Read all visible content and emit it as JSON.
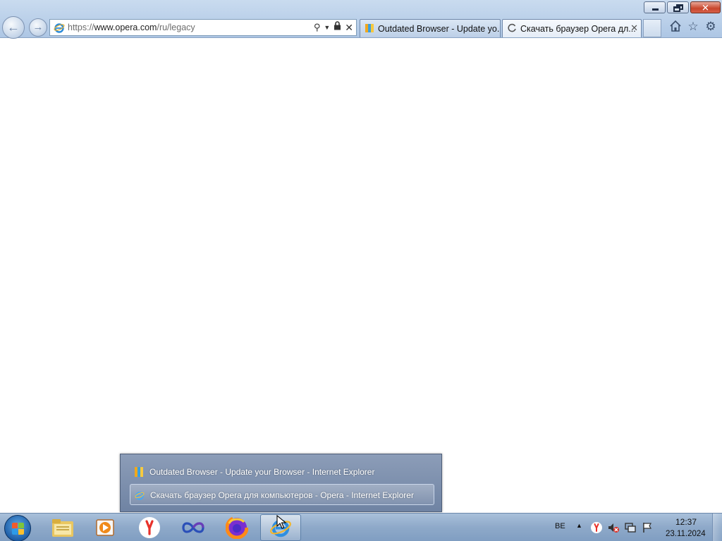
{
  "browser": {
    "address": {
      "scheme": "https://",
      "host": "www.opera.com",
      "path": "/ru/legacy"
    },
    "tabs": [
      {
        "title": "Outdated Browser - Update yo...",
        "active": false
      },
      {
        "title": "Скачать браузер Opera дл...",
        "active": true
      }
    ]
  },
  "jump_list": {
    "items": [
      {
        "label": "Outdated Browser - Update your Browser - Internet Explorer",
        "selected": false
      },
      {
        "label": "Скачать браузер Opera для компьютеров - Opera - Internet Explorer",
        "selected": true
      }
    ]
  },
  "taskbar": {
    "apps": [
      "file-explorer",
      "media-player",
      "yandex-browser",
      "infinity-app",
      "firefox",
      "internet-explorer"
    ],
    "language": "BE",
    "clock": {
      "time": "12:37",
      "date": "23.11.2024"
    }
  },
  "colors": {
    "chrome_bg": "#b9cfe9",
    "taskbar_bg": "#8ea9c9",
    "close_button": "#c8452c",
    "popup_bg": "#7d8fae"
  }
}
